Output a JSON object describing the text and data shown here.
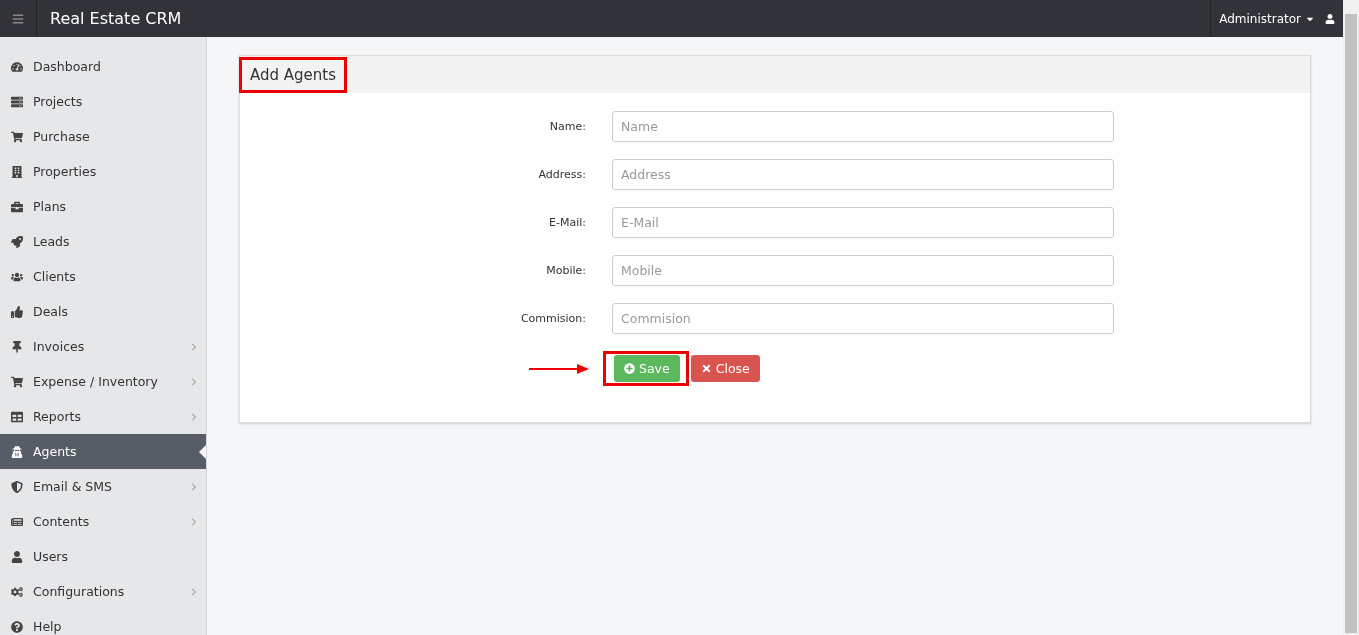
{
  "topbar": {
    "title": "Real Estate CRM",
    "user": "Administrator"
  },
  "sidebar": {
    "items": [
      {
        "label": "Dashboard",
        "selected": false,
        "submenu": false
      },
      {
        "label": "Projects",
        "selected": false,
        "submenu": false
      },
      {
        "label": "Purchase",
        "selected": false,
        "submenu": false
      },
      {
        "label": "Properties",
        "selected": false,
        "submenu": false
      },
      {
        "label": "Plans",
        "selected": false,
        "submenu": false
      },
      {
        "label": "Leads",
        "selected": false,
        "submenu": false
      },
      {
        "label": "Clients",
        "selected": false,
        "submenu": false
      },
      {
        "label": "Deals",
        "selected": false,
        "submenu": false
      },
      {
        "label": "Invoices",
        "selected": false,
        "submenu": true
      },
      {
        "label": "Expense / Inventory",
        "selected": false,
        "submenu": true
      },
      {
        "label": "Reports",
        "selected": false,
        "submenu": true
      },
      {
        "label": "Agents",
        "selected": true,
        "submenu": false
      },
      {
        "label": "Email & SMS",
        "selected": false,
        "submenu": true
      },
      {
        "label": "Contents",
        "selected": false,
        "submenu": true
      },
      {
        "label": "Users",
        "selected": false,
        "submenu": false
      },
      {
        "label": "Configurations",
        "selected": false,
        "submenu": true
      },
      {
        "label": "Help",
        "selected": false,
        "submenu": false
      }
    ]
  },
  "panel": {
    "title": "Add Agents",
    "fields": [
      {
        "label": "Name:",
        "placeholder": "Name"
      },
      {
        "label": "Address:",
        "placeholder": "Address"
      },
      {
        "label": "E-Mail:",
        "placeholder": "E-Mail"
      },
      {
        "label": "Mobile:",
        "placeholder": "Mobile"
      },
      {
        "label": "Commision:",
        "placeholder": "Commision"
      }
    ],
    "buttons": [
      {
        "label": "Save",
        "kind": "save"
      },
      {
        "label": "Close",
        "kind": "close"
      }
    ]
  }
}
